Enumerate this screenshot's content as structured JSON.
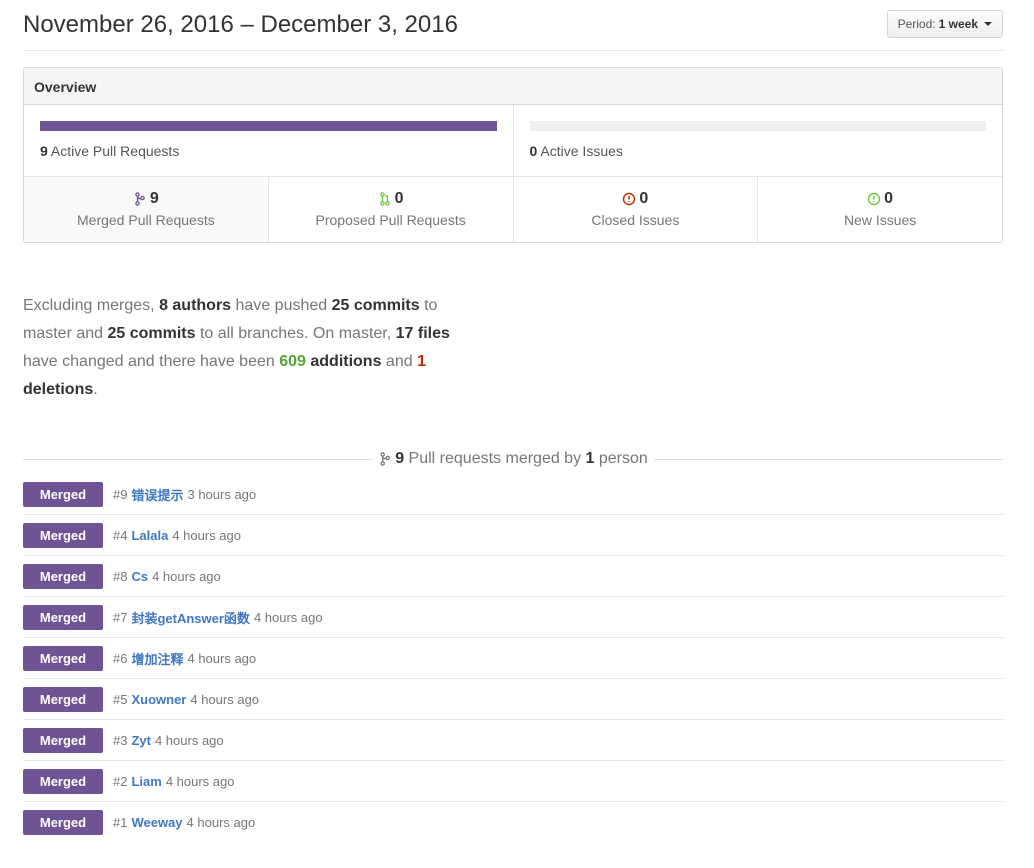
{
  "header": {
    "date_range": "November 26, 2016 – December 3, 2016",
    "period_label": "Period:",
    "period_value": "1 week"
  },
  "overview": {
    "title": "Overview",
    "pull_requests_bar": {
      "count": "9",
      "label": "Active Pull Requests",
      "fill_fraction": 1.0
    },
    "issues_bar": {
      "count": "0",
      "label": "Active Issues",
      "fill_fraction": 0.0
    },
    "stats": [
      {
        "count": "9",
        "label": "Merged Pull Requests",
        "icon": "git-merge-icon",
        "color": "#6e5494"
      },
      {
        "count": "0",
        "label": "Proposed Pull Requests",
        "icon": "git-pull-request-icon",
        "color": "#6cc644"
      },
      {
        "count": "0",
        "label": "Closed Issues",
        "icon": "issue-closed-icon",
        "color": "#bd2c00"
      },
      {
        "count": "0",
        "label": "New Issues",
        "icon": "issue-opened-icon",
        "color": "#6cc644"
      }
    ]
  },
  "summary": {
    "t1": "Excluding merges, ",
    "authors": "8 authors",
    "t2": " have pushed ",
    "commits_master": "25 commits",
    "t3": " to master and ",
    "commits_all": "25 commits",
    "t4": " to all branches. On master, ",
    "files": "17 files",
    "t5": " have changed and there have been ",
    "additions_num": "609",
    "additions_word": " additions",
    "t6": " and ",
    "deletions_num": "1",
    "deletions_word": "deletions",
    "t7": "."
  },
  "merged_section": {
    "count": "9",
    "text1": " Pull requests merged by ",
    "people": "1",
    "text2": " person"
  },
  "pull_requests": [
    {
      "badge": "Merged",
      "number": "#9",
      "title": "错误提示",
      "time": "3 hours ago"
    },
    {
      "badge": "Merged",
      "number": "#4",
      "title": "Lalala",
      "time": "4 hours ago"
    },
    {
      "badge": "Merged",
      "number": "#8",
      "title": "Cs",
      "time": "4 hours ago"
    },
    {
      "badge": "Merged",
      "number": "#7",
      "title": "封装getAnswer函数",
      "time": "4 hours ago"
    },
    {
      "badge": "Merged",
      "number": "#6",
      "title": "增加注释",
      "time": "4 hours ago"
    },
    {
      "badge": "Merged",
      "number": "#5",
      "title": "Xuowner",
      "time": "4 hours ago"
    },
    {
      "badge": "Merged",
      "number": "#3",
      "title": "Zyt",
      "time": "4 hours ago"
    },
    {
      "badge": "Merged",
      "number": "#2",
      "title": "Liam",
      "time": "4 hours ago"
    },
    {
      "badge": "Merged",
      "number": "#1",
      "title": "Weeway",
      "time": "4 hours ago"
    }
  ]
}
